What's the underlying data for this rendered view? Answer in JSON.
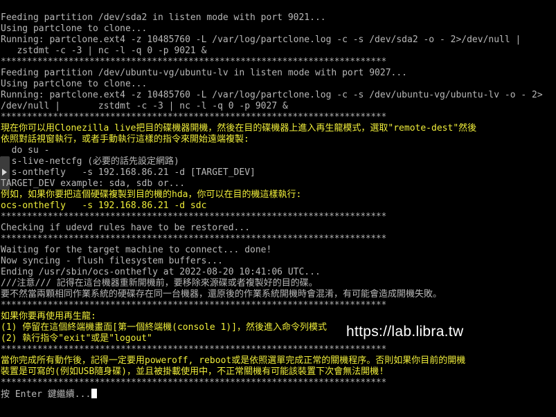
{
  "terminal": {
    "lines": [
      {
        "text": "Feeding partition /dev/sda2 in listen mode with port 9021...",
        "color": "gray"
      },
      {
        "text": "Using partclone to clone...",
        "color": "gray"
      },
      {
        "text": "Running: partclone.ext4 -z 10485760 -L /var/log/partclone.log -c -s /dev/sda2 -o - 2>/dev/null |",
        "color": "gray"
      },
      {
        "text": "   zstdmt -c -3 | nc -l -q 0 -p 9021 &",
        "color": "gray"
      },
      {
        "text": "**************************************************************************",
        "color": "stars"
      },
      {
        "text": "Feeding partition /dev/ubuntu-vg/ubuntu-lv in listen mode with port 9027...",
        "color": "gray"
      },
      {
        "text": "Using partclone to clone...",
        "color": "gray"
      },
      {
        "text": "Running: partclone.ext4 -z 10485760 -L /var/log/partclone.log -c -s /dev/ubuntu-vg/ubuntu-lv -o - 2>",
        "color": "gray"
      },
      {
        "text": "/dev/null |       zstdmt -c -3 | nc -l -q 0 -p 9027 &",
        "color": "gray"
      },
      {
        "text": "**************************************************************************",
        "color": "stars"
      },
      {
        "text": "現在你可以用Clonezilla live把目的碟機器開機，然後在目的碟機器上進入再生龍模式，選取\"remote-dest\"然後",
        "color": "yellow"
      },
      {
        "text": "依照對話視窗執行，或者手動執行這樣的指令來開始遠端複製:",
        "color": "yellow"
      },
      {
        "text": "  do su -",
        "color": "gray"
      },
      {
        "text": "  s-live-netcfg (必要的話先設定網路)",
        "color": "gray"
      },
      {
        "text": "  s-onthefly   -s 192.168.86.21 -d [TARGET_DEV]",
        "color": "gray"
      },
      {
        "text": "TARGET_DEV example: sda, sdb or...",
        "color": "gray"
      },
      {
        "text": "例如，如果你要把這個硬碟複製到目的機的hda，你可以在目的機這樣執行:",
        "color": "yellow"
      },
      {
        "text": "ocs-onthefly   -s 192.168.86.21 -d sdc",
        "color": "yellow"
      },
      {
        "text": "**************************************************************************",
        "color": "stars"
      },
      {
        "text": "Checking if udevd rules have to be restored...",
        "color": "gray"
      },
      {
        "text": "**************************************************************************",
        "color": "stars"
      },
      {
        "text": "Waiting for the target machine to connect... done!",
        "color": "gray"
      },
      {
        "text": "Now syncing - flush filesystem buffers...",
        "color": "gray"
      },
      {
        "text": "Ending /usr/sbin/ocs-onthefly at 2022-08-20 10:41:06 UTC...",
        "color": "gray"
      },
      {
        "text": "///注意/// 記得在這台機器重新開機前，要移除來源碟或者複製好的目的碟。",
        "color": "gray"
      },
      {
        "text": "要不然當兩顆相同作業系統的硬碟存在同一台機器，還原後的作業系統開機時會混淆，有可能會造成開機失敗。",
        "color": "gray"
      },
      {
        "text": "**************************************************************************",
        "color": "stars"
      },
      {
        "text": "如果你要再使用再生龍:",
        "color": "yellow"
      },
      {
        "text": "(1) 停留在這個終端機畫面[第一個終端機(console 1)]，然後進入命令列模式",
        "color": "yellow"
      },
      {
        "text": "(2) 執行指令\"exit\"或是\"logout\"",
        "color": "yellow"
      },
      {
        "text": "**************************************************************************",
        "color": "stars"
      },
      {
        "text": "當你完成所有動作後，記得一定要用poweroff, reboot或是依照選單完成正常的關機程序。否則如果你目前的開機",
        "color": "yellow"
      },
      {
        "text": "裝置是可寫的(例如USB隨身碟)，並且被掛載使用中，不正常關機有可能該裝置下次會無法開機!",
        "color": "yellow"
      },
      {
        "text": "**************************************************************************",
        "color": "stars"
      },
      {
        "text": "按 Enter 鍵繼續...",
        "color": "gray",
        "cursor": true
      }
    ]
  },
  "watermark": {
    "text": "https://lab.libra.tw"
  },
  "colors": {
    "background": "#000000",
    "gray": "#b8b8b8",
    "yellow": "#f0ee3a"
  }
}
